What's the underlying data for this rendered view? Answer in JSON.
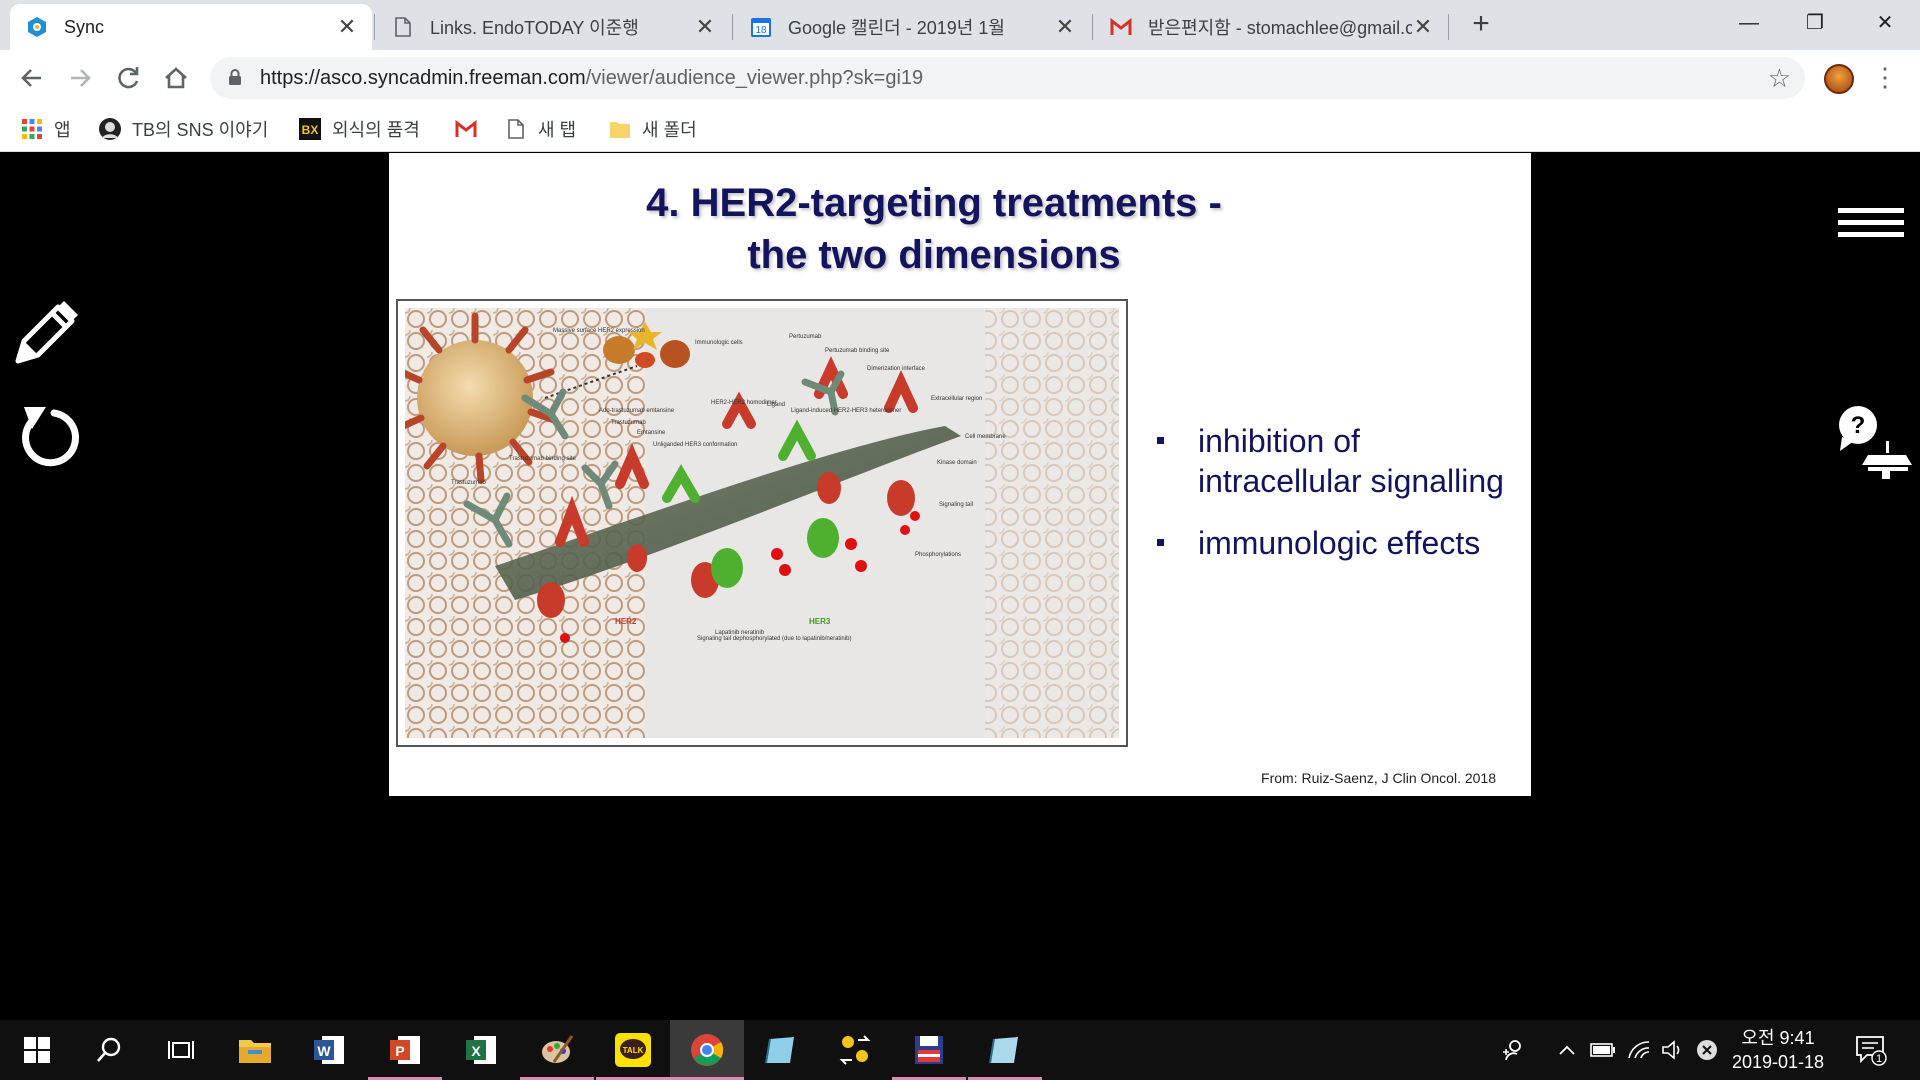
{
  "browser": {
    "tabs": [
      {
        "title": "Sync",
        "icon": "sync-app-icon",
        "active": true
      },
      {
        "title": "Links. EndoTODAY 이준행",
        "icon": "page-icon",
        "active": false
      },
      {
        "title": "Google 캘린더 - 2019년 1월",
        "icon": "calendar-icon",
        "calendar_day": "18",
        "active": false
      },
      {
        "title": "받은편지함 - stomachlee@gmail.com",
        "icon": "gmail-icon",
        "active": false
      }
    ],
    "new_tab_label": "+",
    "window_controls": {
      "minimize": "—",
      "restore": "❐",
      "close": "✕"
    },
    "url_host": "https://asco.syncadmin.freeman.com",
    "url_path": "/viewer/audience_viewer.php?sk=gi19",
    "bookmarks": [
      {
        "label": "앱",
        "icon": "apps-grid-icon"
      },
      {
        "label": "TB의 SNS 이야기",
        "icon": "portrait-icon"
      },
      {
        "label": "외식의 품격",
        "icon": "bx-icon",
        "icon_text": "BX"
      },
      {
        "label": "",
        "icon": "gmail-icon"
      },
      {
        "label": "새 탭",
        "icon": "page-icon"
      },
      {
        "label": "새 폴더",
        "icon": "folder-icon"
      }
    ]
  },
  "slide": {
    "title_line1": "4. HER2-targeting treatments -",
    "title_line2": "the two dimensions",
    "bullets": [
      "inhibition of intracellular signalling",
      "immunologic effects"
    ],
    "citation": "From: Ruiz-Saenz, J Clin Oncol. 2018",
    "figure_labels": {
      "massive": "Massive surface HER2 expression",
      "immuno": "Immunologic cells",
      "pertuzumab": "Pertuzumab",
      "pert_site": "Pertuzumab binding site",
      "dimer_if": "Dimerization interface",
      "extracellular": "Extracellular region",
      "cell_membrane": "Cell membrane",
      "kinase": "Kinase domain",
      "signal_tail": "Signaling tail",
      "phospho": "Phosphorylations",
      "ado": "Ado-trastuzumab emtansine",
      "trastuzumab_top": "Trastuzumab",
      "emtansine": "Emtansine",
      "homodimer": "HER2-HER2 homodimer",
      "ligand": "Ligand",
      "heterodimer": "Ligand-induced HER2-HER3 heterodimer",
      "unliganded": "Unliganded HER3 conformation",
      "tras_site": "Trastuzumab binding site",
      "trastuzumab_left": "Trastuzumab",
      "lapatinib": "Lapatinib neratinib",
      "deph": "Signaling tail dephosphorylated (due to lapatinib/neratinib)",
      "her2": "HER2",
      "her3": "HER3"
    }
  },
  "viewer": {
    "help_label": "?"
  },
  "taskbar": {
    "clock_time": "오전 9:41",
    "clock_date": "2019-01-18",
    "notification_count": "1"
  },
  "colors": {
    "title_navy": "#14145e",
    "her2_red": "#c83a2a",
    "her3_green": "#4fb030",
    "membrane": "#4b5a44"
  }
}
